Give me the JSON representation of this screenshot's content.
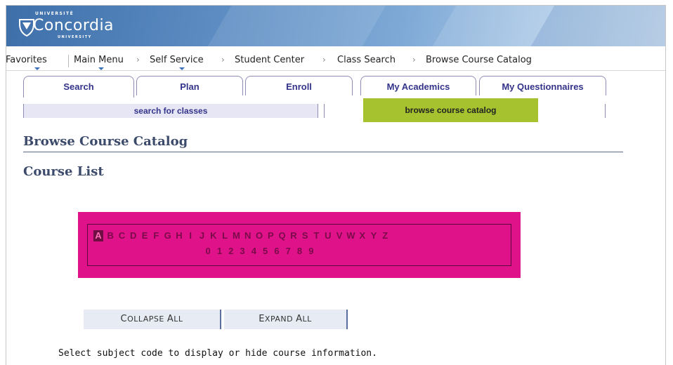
{
  "header": {
    "univ_top": "UNIVERSITÉ",
    "logo_name": "Concordia",
    "univ_bottom": "UNIVERSITY",
    "colors": {
      "header_blue": "#3e6fa9",
      "header_light": "#c9dcef"
    }
  },
  "navbar": {
    "favorites": "Favorites",
    "main_menu": "Main Menu",
    "self_service": "Self Service",
    "student_center": "Student Center",
    "class_search": "Class Search",
    "browse_catalog": "Browse Course Catalog",
    "separator": "›"
  },
  "tabs": [
    {
      "label": "Search",
      "active": true
    },
    {
      "label": "Plan",
      "active": false
    },
    {
      "label": "Enroll",
      "active": false
    },
    {
      "label": "My Academics",
      "active": false
    },
    {
      "label": "My Questionnaires",
      "active": false
    }
  ],
  "subtabs": {
    "search_for_classes": "search for classes",
    "browse_course_catalog": "browse course catalog",
    "active_color": "#a6c22e"
  },
  "page": {
    "title": "Browse Course Catalog",
    "section_title": "Course List"
  },
  "letters": [
    "A",
    "B",
    "C",
    "D",
    "E",
    "F",
    "G",
    "H",
    "I",
    "J",
    "K",
    "L",
    "M",
    "N",
    "O",
    "P",
    "Q",
    "R",
    "S",
    "T",
    "U",
    "V",
    "W",
    "X",
    "Y",
    "Z"
  ],
  "digits": [
    "0",
    "1",
    "2",
    "3",
    "4",
    "5",
    "6",
    "7",
    "8",
    "9"
  ],
  "selected_letter": "A",
  "panel_color": "#e0128a",
  "buttons": {
    "collapse_first": "C",
    "collapse_rest": "OLLAPSE ",
    "collapse_a": "A",
    "collapse_ll": "LL",
    "expand_first": "E",
    "expand_rest": "XPAND ",
    "expand_a": "A",
    "expand_ll": "LL"
  },
  "instructions": "Select subject code to display or hide course information."
}
